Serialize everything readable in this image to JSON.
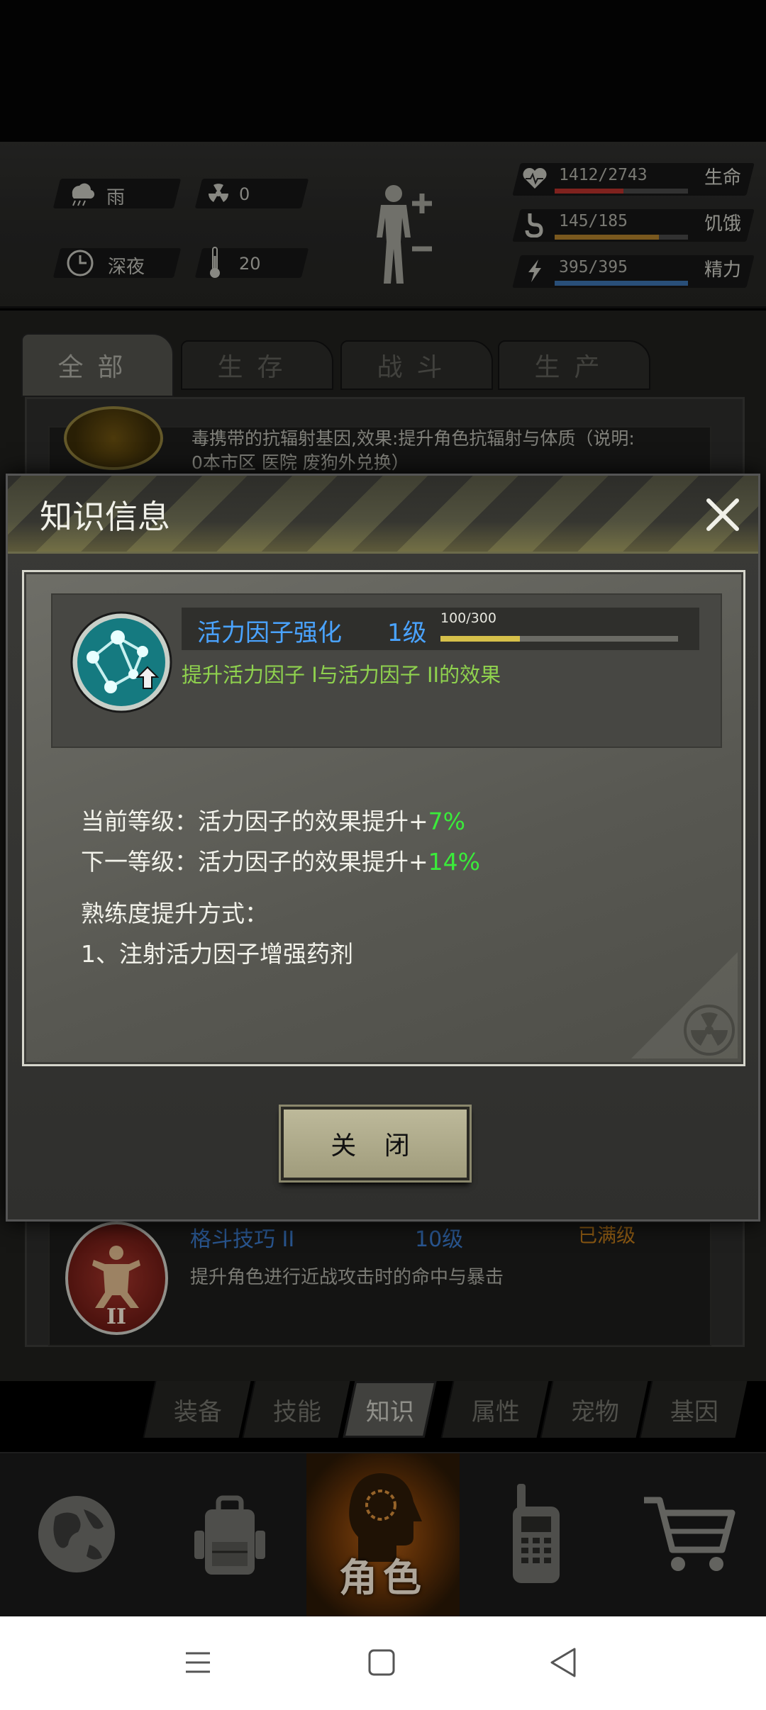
{
  "status": {
    "weather": "雨",
    "radiation": "0",
    "time_of_day": "深夜",
    "temperature": "20",
    "health": {
      "value": "1412/2743",
      "label": "生命",
      "fraction": 0.515,
      "color": "#b0302a"
    },
    "hunger": {
      "value": "145/185",
      "label": "饥饿",
      "fraction": 0.784,
      "color": "#a87a2a"
    },
    "energy": {
      "value": "395/395",
      "label": "精力",
      "fraction": 1.0,
      "color": "#3a6ea8"
    }
  },
  "tabs": [
    "全部",
    "生存",
    "战斗",
    "生产"
  ],
  "list_items": [
    {
      "desc_line1": "毒携带的抗辐射基因,效果:提升角色抗辐射与体质（说明:",
      "desc_line2": "0本市区 医院 废狗外兑换）"
    },
    {
      "name": "格斗技巧 II",
      "level": "10级",
      "status": "已满级",
      "desc": "提升角色进行近战攻击时的命中与暴击"
    }
  ],
  "dialog": {
    "title": "知识信息",
    "skill": {
      "name": "活力因子强化",
      "level": "1级",
      "exp": "100/300",
      "exp_fraction": 0.333,
      "desc": "提升活力因子 I与活力因子 II的效果"
    },
    "current_prefix": "当前等级：活力因子的效果提升+",
    "current_value": "7%",
    "next_prefix": "下一等级：活力因子的效果提升+",
    "next_value": "14%",
    "method_title": "熟练度提升方式：",
    "method_1": "1、注射活力因子增强药剂",
    "close_label": "关 闭"
  },
  "subtabs": [
    "装备",
    "技能",
    "知识",
    "属性",
    "宠物",
    "基因"
  ],
  "nav": {
    "active_label": "角色"
  },
  "icons": [
    "rain-icon",
    "radiation-icon",
    "clock-icon",
    "thermometer-icon",
    "heart-icon",
    "stomach-icon",
    "energy-icon",
    "body-icon",
    "globe-icon",
    "backpack-icon",
    "character-icon",
    "radio-icon",
    "cart-icon"
  ]
}
